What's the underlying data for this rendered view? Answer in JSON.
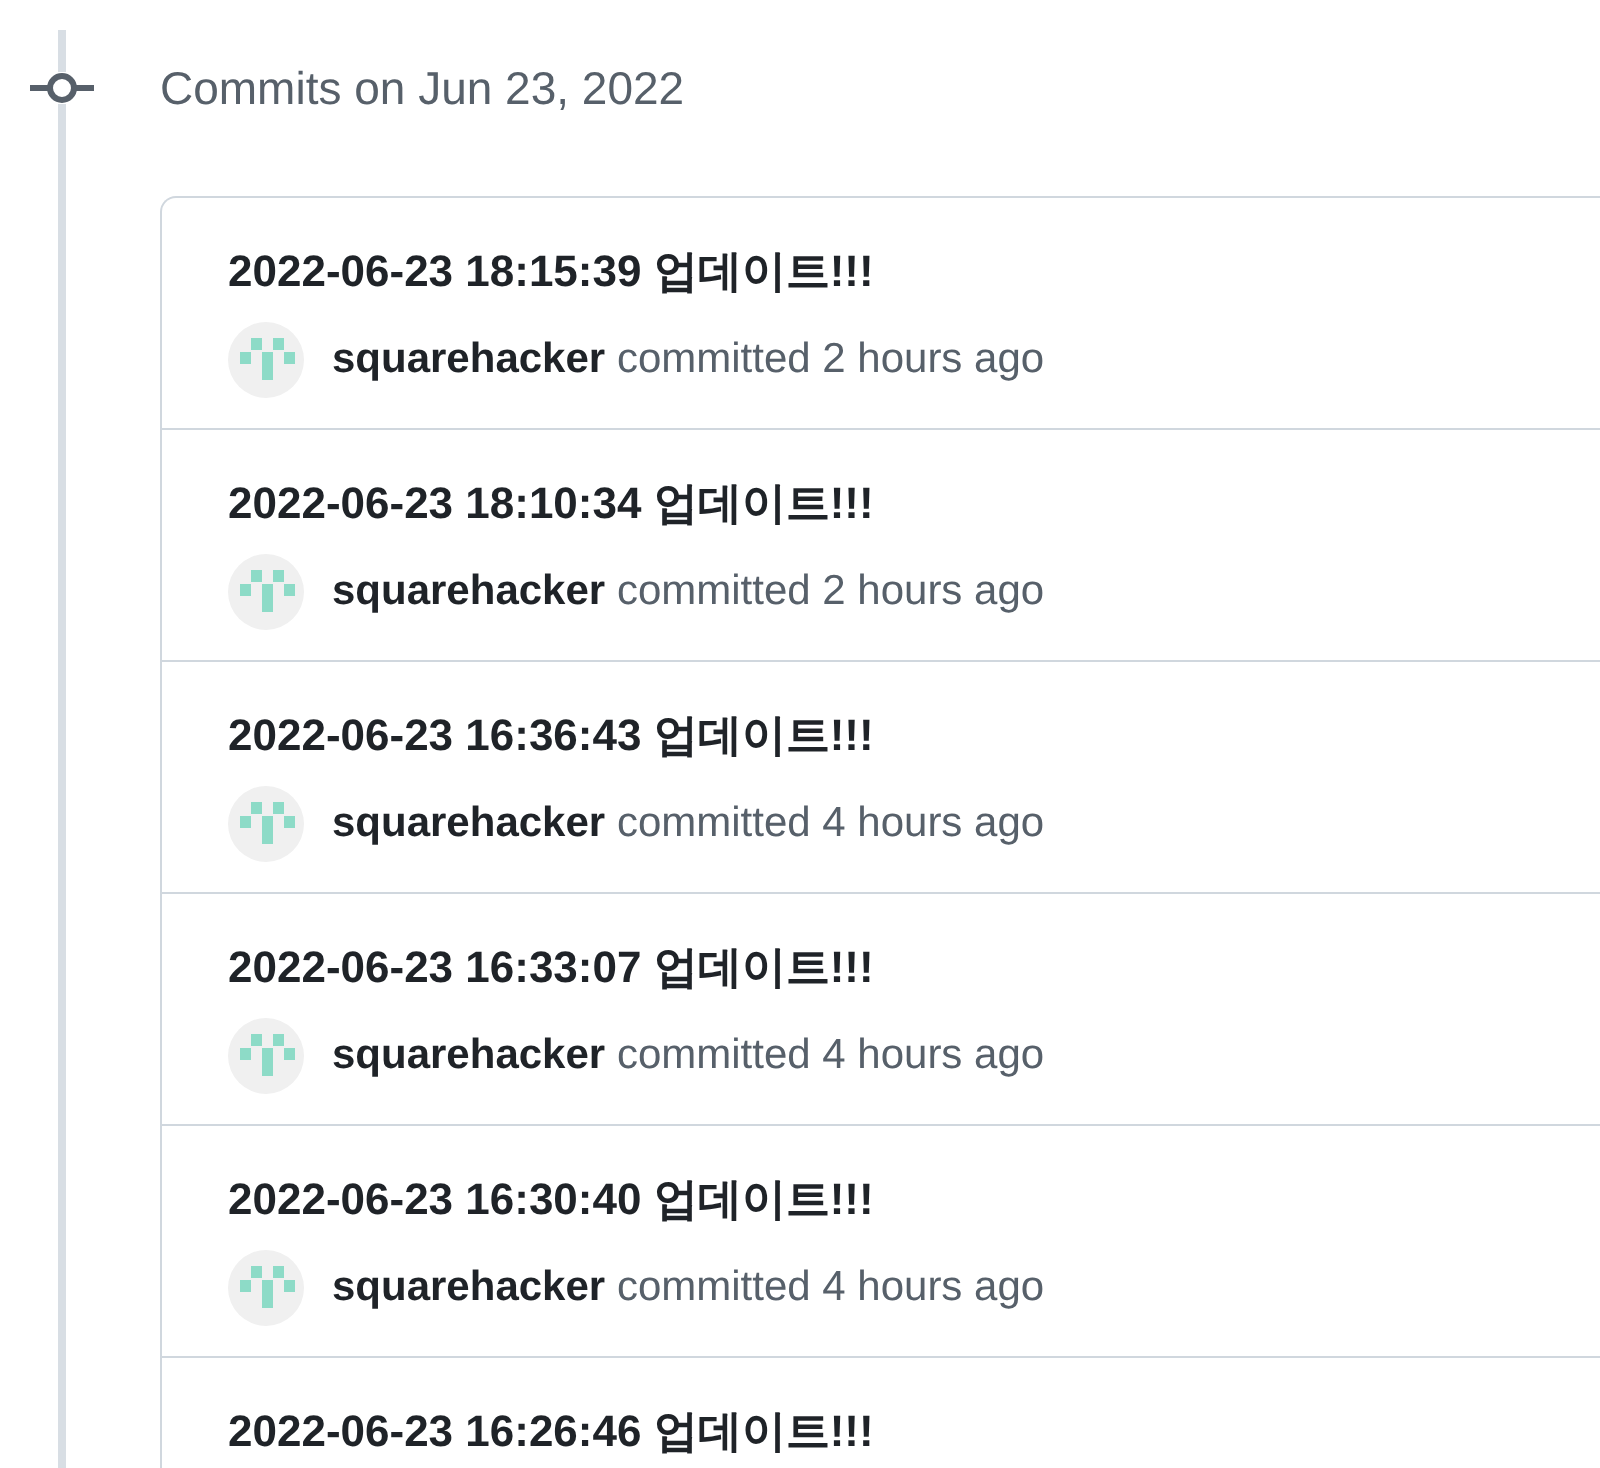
{
  "group": {
    "heading": "Commits on Jun 23, 2022"
  },
  "commits": [
    {
      "title": "2022-06-23 18:15:39 업데이트!!!",
      "author": "squarehacker",
      "action": "committed",
      "time": "2 hours ago"
    },
    {
      "title": "2022-06-23 18:10:34 업데이트!!!",
      "author": "squarehacker",
      "action": "committed",
      "time": "2 hours ago"
    },
    {
      "title": "2022-06-23 16:36:43 업데이트!!!",
      "author": "squarehacker",
      "action": "committed",
      "time": "4 hours ago"
    },
    {
      "title": "2022-06-23 16:33:07 업데이트!!!",
      "author": "squarehacker",
      "action": "committed",
      "time": "4 hours ago"
    },
    {
      "title": "2022-06-23 16:30:40 업데이트!!!",
      "author": "squarehacker",
      "action": "committed",
      "time": "4 hours ago"
    },
    {
      "title": "2022-06-23 16:26:46 업데이트!!!"
    }
  ]
}
